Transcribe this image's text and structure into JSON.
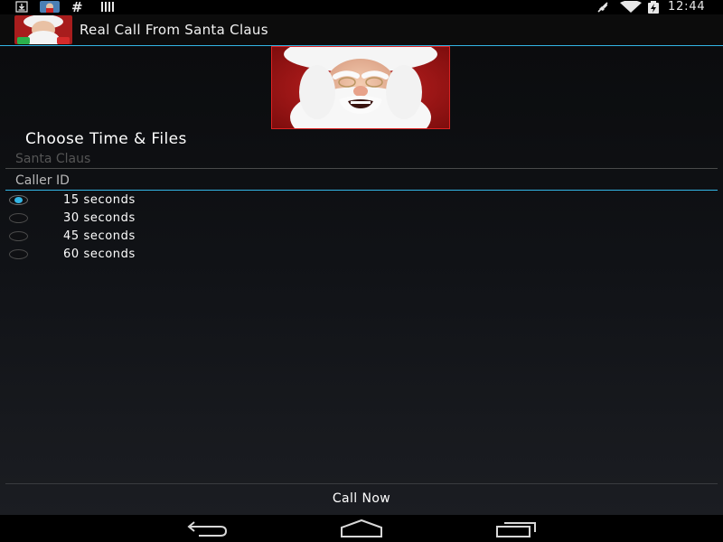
{
  "status_bar": {
    "time": "12:44",
    "left_icons": [
      "download-icon",
      "photo-notification-icon",
      "hash-icon",
      "barcode-icon"
    ],
    "right_icons": [
      "muted-icon",
      "wifi-icon",
      "battery-icon"
    ]
  },
  "app": {
    "title": "Real Call From Santa Claus",
    "icon": "santa-app-icon"
  },
  "form": {
    "heading": "Choose Time & Files",
    "name_placeholder": "Santa Claus",
    "callerid_placeholder": "Caller ID",
    "options": [
      {
        "label": "15 seconds",
        "checked": true
      },
      {
        "label": "30 seconds",
        "checked": false
      },
      {
        "label": "45 seconds",
        "checked": false
      },
      {
        "label": "60 seconds",
        "checked": false
      }
    ],
    "call_button_label": "Call Now"
  },
  "nav": {
    "buttons": [
      "back-icon",
      "home-icon",
      "recent-apps-icon"
    ]
  },
  "colors": {
    "accent": "#33b5e5",
    "photo_border": "#dd2222"
  }
}
